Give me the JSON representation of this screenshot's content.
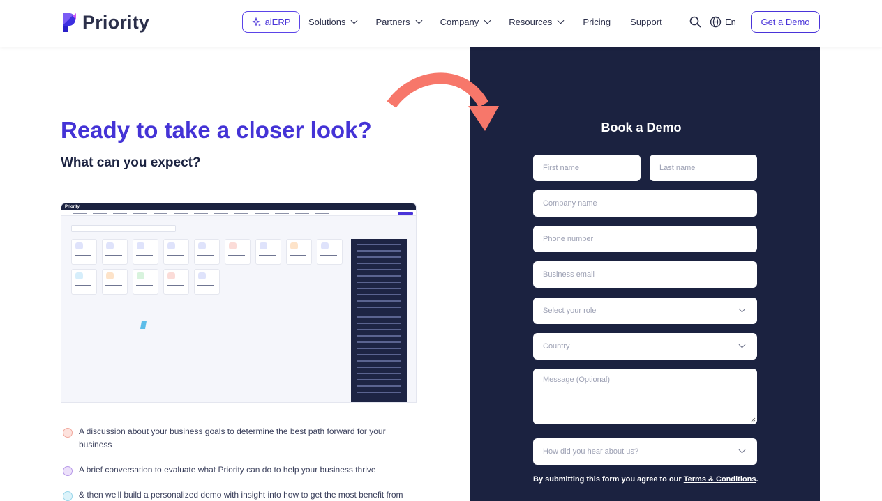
{
  "header": {
    "brand": "Priority",
    "nav": {
      "aierp": "aiERP",
      "items": [
        "Solutions",
        "Partners",
        "Company",
        "Resources",
        "Pricing",
        "Support"
      ]
    },
    "lang": "En",
    "cta": "Get a Demo"
  },
  "hero": {
    "title": "Ready to take a closer look?",
    "subtitle": "What can you expect?"
  },
  "screenshot": {
    "app_name": "Priority"
  },
  "bullets": [
    {
      "text": "A discussion about your business goals to determine the best path forward for your business",
      "color": "#f7c9c1"
    },
    {
      "text": "A brief conversation to evaluate what Priority can do to help your business thrive",
      "color": "#d9c7f3"
    },
    {
      "text": "& then we'll build a personalized demo with insight into how to get the most benefit from",
      "color": "#c8ecf6"
    }
  ],
  "form": {
    "title": "Book a Demo",
    "first_name": "First name",
    "last_name": "Last name",
    "company": "Company name",
    "phone": "Phone number",
    "email": "Business email",
    "role": "Select your role",
    "country": "Country",
    "message": "Message (Optional)",
    "source": "How did you hear about us?",
    "terms_prefix": "By submitting this form you agree to our ",
    "terms_link": "Terms & Conditions",
    "terms_suffix": "."
  },
  "colors": {
    "brand_purple": "#4433d6",
    "panel_navy": "#1b2240",
    "arrow_coral": "#f7776a"
  }
}
